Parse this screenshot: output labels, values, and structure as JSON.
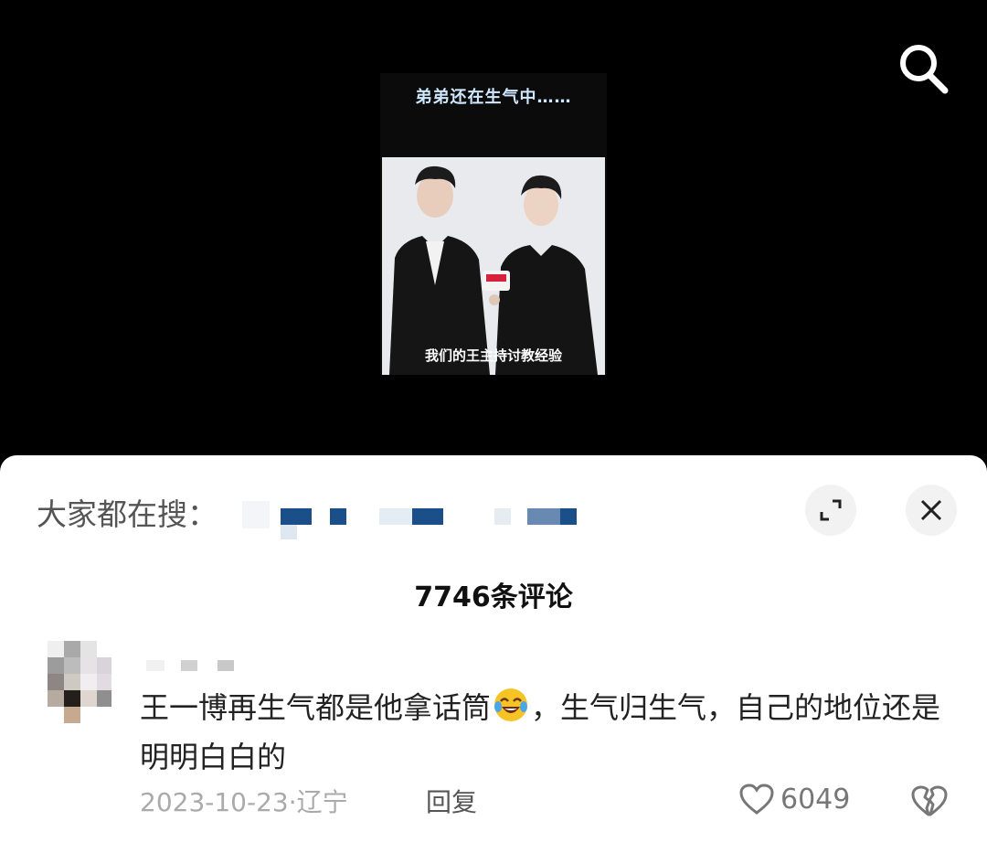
{
  "video": {
    "thumbnail_title": "弟弟还在生气中……",
    "thumbnail_caption": "我们的王主持讨教经验"
  },
  "icons": {
    "search": "search-icon",
    "expand": "expand-icon",
    "close": "close-icon",
    "heart": "heart-icon",
    "dislike": "broken-heart-icon",
    "emoji": "laughing-tears-emoji"
  },
  "sheet": {
    "hot_search_label": "大家都在搜：",
    "comment_count_label": "7746条评论"
  },
  "comment": {
    "text_before_emoji": "王一博再生气都是他拿话筒",
    "text_after_emoji": "，生气归生气，自己的地位还是明明白白的",
    "date_location": "2023-10-23·辽宁",
    "reply_label": "回复",
    "like_count": "6049"
  },
  "colors": {
    "accent_blue": "#1a4f8a",
    "sheet_bg": "#ffffff",
    "top_bg": "#000000"
  }
}
